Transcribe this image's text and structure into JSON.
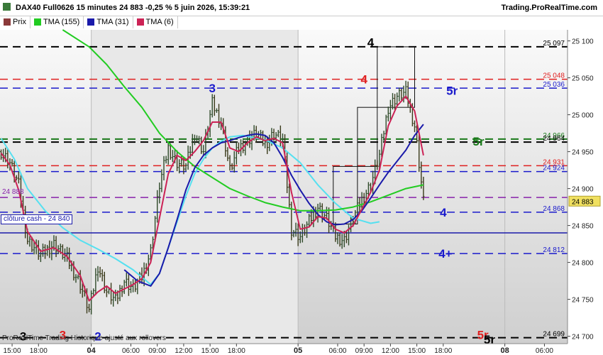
{
  "header": {
    "instrument": "DAX40 Full0626 15 minutes 24 883 -0,25 % 5 juin 2026, 15:39:21",
    "site": "Trading.ProRealTime.com"
  },
  "legend": [
    {
      "label": "Prix",
      "color": "#8b3a3a",
      "icon": "price-swatch-icon"
    },
    {
      "label": "TMA (155)",
      "color": "#22cc22",
      "icon": "swatch-icon"
    },
    {
      "label": "TMA (31)",
      "color": "#1a1aaa",
      "icon": "swatch-icon"
    },
    {
      "label": "TMA (6)",
      "color": "#cc2255",
      "icon": "swatch-icon"
    }
  ],
  "footer": "ProRealTime Trading  Historique ajusté aux rollovers",
  "cloture_label": "clôture cash -  24 840",
  "chart_data": {
    "type": "line",
    "ylim": [
      24690,
      25115
    ],
    "y_ticks": [
      25100,
      25050,
      25000,
      24950,
      24900,
      24850,
      24800,
      24750,
      24700
    ],
    "y_tick_labels": [
      "25 100",
      "25 050",
      "25 000",
      "24 950",
      "24 900",
      "24 850",
      "24 800",
      "24 750",
      "24 700"
    ],
    "x_ticks": [
      {
        "label": "15:00",
        "bar": 5
      },
      {
        "label": "18:00",
        "bar": 17
      },
      {
        "label": "04",
        "bar": 41
      },
      {
        "label": "06:00",
        "bar": 59
      },
      {
        "label": "09:00",
        "bar": 71
      },
      {
        "label": "12:00",
        "bar": 83
      },
      {
        "label": "15:00",
        "bar": 95
      },
      {
        "label": "18:00",
        "bar": 107
      },
      {
        "label": "05",
        "bar": 135
      },
      {
        "label": "06:00",
        "bar": 153
      },
      {
        "label": "09:00",
        "bar": 165
      },
      {
        "label": "12:00",
        "bar": 177
      },
      {
        "label": "15:00",
        "bar": 189
      },
      {
        "label": "18:00",
        "bar": 201
      },
      {
        "label": "08",
        "bar": 229
      },
      {
        "label": "06:00",
        "bar": 247
      }
    ],
    "x_bold_ticks": [
      "04",
      "05",
      "08"
    ],
    "total_bars": 258,
    "price_close_keys": [
      [
        0,
        24950
      ],
      [
        4,
        24935
      ],
      [
        8,
        24905
      ],
      [
        12,
        24830
      ],
      [
        18,
        24810
      ],
      [
        24,
        24825
      ],
      [
        30,
        24805
      ],
      [
        36,
        24770
      ],
      [
        40,
        24735
      ],
      [
        44,
        24795
      ],
      [
        48,
        24760
      ],
      [
        52,
        24748
      ],
      [
        56,
        24775
      ],
      [
        60,
        24765
      ],
      [
        64,
        24780
      ],
      [
        68,
        24815
      ],
      [
        72,
        24905
      ],
      [
        76,
        24955
      ],
      [
        80,
        24935
      ],
      [
        84,
        24930
      ],
      [
        88,
        24975
      ],
      [
        92,
        24950
      ],
      [
        96,
        25015
      ],
      [
        100,
        24990
      ],
      [
        104,
        24925
      ],
      [
        108,
        24955
      ],
      [
        112,
        24965
      ],
      [
        116,
        24975
      ],
      [
        120,
        24960
      ],
      [
        124,
        24975
      ],
      [
        128,
        24965
      ],
      [
        132,
        24845
      ],
      [
        136,
        24835
      ],
      [
        140,
        24855
      ],
      [
        144,
        24875
      ],
      [
        148,
        24860
      ],
      [
        152,
        24835
      ],
      [
        156,
        24830
      ],
      [
        160,
        24860
      ],
      [
        164,
        24885
      ],
      [
        168,
        24905
      ],
      [
        172,
        24945
      ],
      [
        176,
        25010
      ],
      [
        180,
        25025
      ],
      [
        184,
        25030
      ],
      [
        188,
        24985
      ],
      [
        190,
        24935
      ],
      [
        192,
        24883
      ]
    ],
    "series": [
      {
        "name": "TMA (155)",
        "color": "#22cc22",
        "points": [
          [
            28,
            25115
          ],
          [
            40,
            25092
          ],
          [
            48,
            25068
          ],
          [
            56,
            25038
          ],
          [
            64,
            25010
          ],
          [
            72,
            24975
          ],
          [
            80,
            24950
          ],
          [
            88,
            24930
          ],
          [
            96,
            24915
          ],
          [
            104,
            24900
          ],
          [
            112,
            24890
          ],
          [
            120,
            24881
          ],
          [
            128,
            24875
          ],
          [
            136,
            24870
          ],
          [
            144,
            24870
          ],
          [
            152,
            24871
          ],
          [
            160,
            24875
          ],
          [
            168,
            24882
          ],
          [
            176,
            24891
          ],
          [
            184,
            24900
          ],
          [
            192,
            24905
          ]
        ]
      },
      {
        "name": "TMA (31)",
        "color": "#1a1aaa",
        "points": [
          [
            56,
            24790
          ],
          [
            62,
            24775
          ],
          [
            68,
            24768
          ],
          [
            72,
            24785
          ],
          [
            76,
            24820
          ],
          [
            80,
            24858
          ],
          [
            84,
            24898
          ],
          [
            88,
            24928
          ],
          [
            92,
            24945
          ],
          [
            96,
            24955
          ],
          [
            100,
            24962
          ],
          [
            104,
            24965
          ],
          [
            108,
            24969
          ],
          [
            112,
            24972
          ],
          [
            116,
            24974
          ],
          [
            120,
            24972
          ],
          [
            124,
            24962
          ],
          [
            128,
            24942
          ],
          [
            132,
            24918
          ],
          [
            136,
            24898
          ],
          [
            140,
            24880
          ],
          [
            144,
            24865
          ],
          [
            148,
            24855
          ],
          [
            152,
            24851
          ],
          [
            156,
            24852
          ],
          [
            160,
            24858
          ],
          [
            164,
            24870
          ],
          [
            168,
            24887
          ],
          [
            172,
            24905
          ],
          [
            176,
            24922
          ],
          [
            180,
            24937
          ],
          [
            184,
            24952
          ],
          [
            188,
            24972
          ],
          [
            192,
            24987
          ]
        ]
      },
      {
        "name": "TMA (6)",
        "color": "#cc2255",
        "points": [
          [
            0,
            24948
          ],
          [
            4,
            24932
          ],
          [
            8,
            24898
          ],
          [
            12,
            24842
          ],
          [
            18,
            24815
          ],
          [
            24,
            24820
          ],
          [
            30,
            24808
          ],
          [
            36,
            24782
          ],
          [
            40,
            24748
          ],
          [
            44,
            24760
          ],
          [
            48,
            24768
          ],
          [
            52,
            24758
          ],
          [
            56,
            24764
          ],
          [
            60,
            24770
          ],
          [
            64,
            24778
          ],
          [
            68,
            24800
          ],
          [
            72,
            24860
          ],
          [
            76,
            24920
          ],
          [
            80,
            24945
          ],
          [
            84,
            24938
          ],
          [
            88,
            24950
          ],
          [
            92,
            24965
          ],
          [
            96,
            24990
          ],
          [
            100,
            24990
          ],
          [
            104,
            24955
          ],
          [
            108,
            24950
          ],
          [
            112,
            24962
          ],
          [
            116,
            24970
          ],
          [
            120,
            24965
          ],
          [
            124,
            24968
          ],
          [
            128,
            24962
          ],
          [
            132,
            24895
          ],
          [
            136,
            24845
          ],
          [
            140,
            24848
          ],
          [
            144,
            24862
          ],
          [
            148,
            24860
          ],
          [
            152,
            24845
          ],
          [
            156,
            24840
          ],
          [
            160,
            24850
          ],
          [
            164,
            24872
          ],
          [
            168,
            24895
          ],
          [
            172,
            24925
          ],
          [
            176,
            24985
          ],
          [
            180,
            25012
          ],
          [
            184,
            25025
          ],
          [
            188,
            25005
          ],
          [
            190,
            24975
          ],
          [
            192,
            24945
          ]
        ]
      },
      {
        "name": "cyan",
        "color": "#55e0f0",
        "points": [
          [
            0,
            24968
          ],
          [
            6,
            24940
          ],
          [
            12,
            24900
          ],
          [
            20,
            24870
          ],
          [
            28,
            24847
          ],
          [
            36,
            24830
          ],
          [
            44,
            24818
          ],
          [
            52,
            24805
          ],
          [
            60,
            24790
          ],
          [
            68,
            24770
          ],
          [
            72,
            24785
          ],
          [
            76,
            24820
          ],
          [
            80,
            24855
          ],
          [
            84,
            24890
          ],
          [
            88,
            24920
          ],
          [
            92,
            24940
          ],
          [
            96,
            24955
          ],
          [
            100,
            24964
          ],
          [
            104,
            24970
          ],
          [
            110,
            24972
          ],
          [
            120,
            24966
          ],
          [
            128,
            24955
          ],
          [
            136,
            24935
          ],
          [
            144,
            24905
          ],
          [
            152,
            24880
          ],
          [
            160,
            24860
          ],
          [
            168,
            24853
          ],
          [
            172,
            24855
          ]
        ]
      }
    ],
    "levels": [
      {
        "value": 25092,
        "color": "#000000",
        "width": 2,
        "label": "25 097",
        "label_color": "#000000"
      },
      {
        "value": 25048,
        "color": "#e02020",
        "width": 1.5,
        "label": "25 048",
        "label_color": "#e02020"
      },
      {
        "value": 25036,
        "color": "#1a1acc",
        "width": 1.5,
        "label": "25 036",
        "label_color": "#1a1acc"
      },
      {
        "value": 24967,
        "color": "#1a7a1a",
        "width": 2,
        "label": "24 966",
        "label_color": "#1a7a1a"
      },
      {
        "value": 24963,
        "color": "#000000",
        "width": 2,
        "label": "24 964",
        "label_color": "#000000"
      },
      {
        "value": 24931,
        "color": "#e02020",
        "width": 1.5,
        "label": "24 931",
        "label_color": "#e02020"
      },
      {
        "value": 24923,
        "color": "#1a1acc",
        "width": 1.5,
        "label": "24 924",
        "label_color": "#1a1acc"
      },
      {
        "value": 24888,
        "color": "#8822aa",
        "width": 1.5,
        "label": "",
        "label_color": "#8822aa"
      },
      {
        "value": 24868,
        "color": "#1a1acc",
        "width": 1.5,
        "label": "24 868",
        "label_color": "#1a1acc"
      },
      {
        "value": 24812,
        "color": "#1a1acc",
        "width": 1.5,
        "label": "24 812",
        "label_color": "#1a1acc"
      },
      {
        "value": 24698,
        "color": "#000000",
        "width": 2,
        "label": "24 699",
        "label_color": "#000000"
      }
    ],
    "cloture_value": 24840,
    "current_price": {
      "value": 24883,
      "label": "24 883"
    },
    "left_label": {
      "value": 24888,
      "label": "24 888",
      "color": "#8822aa"
    },
    "annotations": [
      {
        "text": "4",
        "bar": 168,
        "value": 25098,
        "color": "#000000",
        "size": 17
      },
      {
        "text": "4",
        "bar": 165,
        "value": 25048,
        "color": "#e02020",
        "size": 17
      },
      {
        "text": "3",
        "bar": 96,
        "value": 25036,
        "color": "#1a1acc",
        "size": 17
      },
      {
        "text": "5r",
        "bar": 205,
        "value": 25033,
        "color": "#1a1acc",
        "size": 17
      },
      {
        "text": "5r",
        "bar": 217,
        "value": 24964,
        "color": "#1a7a1a",
        "size": 17
      },
      {
        "text": "4",
        "bar": 201,
        "value": 24868,
        "color": "#1a1acc",
        "size": 17
      },
      {
        "text": "4+",
        "bar": 202,
        "value": 24812,
        "color": "#1a1acc",
        "size": 17
      },
      {
        "text": "3",
        "bar": 10,
        "value": 24700,
        "color": "#000000",
        "size": 17
      },
      {
        "text": "3",
        "bar": 28,
        "value": 24702,
        "color": "#e02020",
        "size": 17
      },
      {
        "text": "2",
        "bar": 44,
        "value": 24700,
        "color": "#1a1acc",
        "size": 17
      },
      {
        "text": "5r",
        "bar": 219,
        "value": 24702,
        "color": "#e02020",
        "size": 17
      },
      {
        "text": "5r",
        "bar": 222,
        "value": 24696,
        "color": "#000000",
        "size": 17
      }
    ],
    "boxes": [
      {
        "bar0": 151,
        "bar1": 162,
        "top": 24930,
        "bottom": 24852
      },
      {
        "bar0": 162,
        "bar1": 171,
        "top": 25010,
        "bottom": 24930
      },
      {
        "bar0": 171,
        "bar1": 188,
        "top": 25092,
        "bottom": 25010
      }
    ]
  }
}
